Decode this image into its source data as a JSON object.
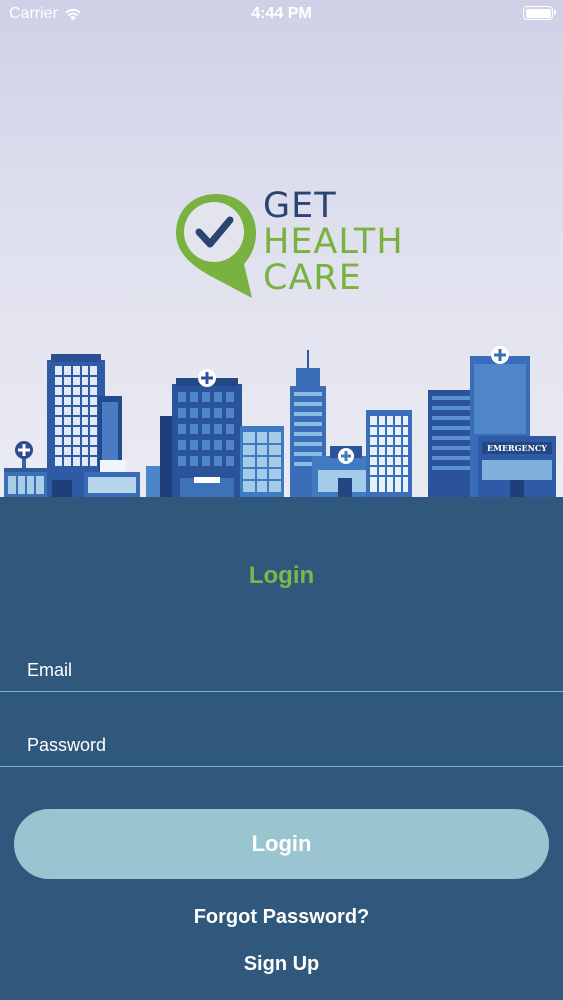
{
  "status_bar": {
    "carrier": "Carrier",
    "time": "4:44 PM"
  },
  "logo": {
    "line1": "GET",
    "line2": "HEALTH",
    "line3": "CARE",
    "colors": {
      "dark": "#2b4470",
      "green": "#79b241"
    }
  },
  "illustration": {
    "sign_text": "EMERGENCY"
  },
  "login_form": {
    "title": "Login",
    "email_placeholder": "Email",
    "password_placeholder": "Password",
    "login_button_label": "Login",
    "forgot_password_label": "Forgot Password?",
    "sign_up_label": "Sign Up"
  },
  "colors": {
    "form_background": "#2f587c",
    "title_green": "#79b94a",
    "button_background": "#9ac4cf",
    "field_underline": "#79b8de"
  }
}
